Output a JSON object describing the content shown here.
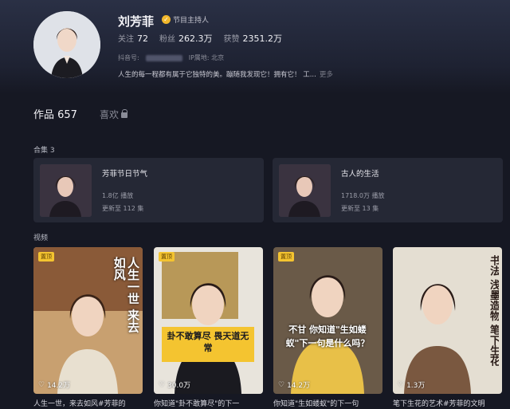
{
  "profile": {
    "name": "刘芳菲",
    "verify_label": "节目主持人",
    "following_label": "关注",
    "following": "72",
    "followers_label": "粉丝",
    "followers": "262.3万",
    "likes_label": "获赞",
    "likes": "2351.2万",
    "douyin_id_label": "抖音号:",
    "ip_label": "IP属地: 北京",
    "bio": "人生的每一程都有属于它独特的美。蹦随我发现它！拥有它！ 工...",
    "bio_more": "更多"
  },
  "tabs": {
    "works_label": "作品 657",
    "likes_label": "喜欢"
  },
  "collections_label": "合集 3",
  "collections": [
    {
      "title": "芳菲节日节气",
      "plays": "1.8亿 播放",
      "updated": "更新至 112 集"
    },
    {
      "title": "古人的生活",
      "plays": "1718.0万 播放",
      "updated": "更新至 13 集"
    }
  ],
  "videos_label": "视频",
  "videos": [
    {
      "pinned": "置顶",
      "likes": "14.2万",
      "overlay_text": "人生一世 来去如风",
      "caption": "人生一世，来去如风#芳菲的"
    },
    {
      "pinned": "置顶",
      "likes": "30.0万",
      "overlay_text": "卦不敢算尽 畏天道无常",
      "caption": "你知道\"卦不敢算尽\"的下一"
    },
    {
      "pinned": "置顶",
      "likes": "14.2万",
      "overlay_text": "不甘 你知道\"生如蝼蚁\"下一句是什么吗？",
      "caption": "你知道\"生如蝼蚁\"的下一句"
    },
    {
      "pinned": "",
      "likes": "1.3万",
      "overlay_text": "书法 浅墨造物 笔下生花",
      "caption": "笔下生花的艺术#芳菲的文明"
    }
  ],
  "colors": {
    "bg": "#161823",
    "card": "#252835",
    "pin": "#f4c430",
    "verify": "#f2b82c"
  }
}
